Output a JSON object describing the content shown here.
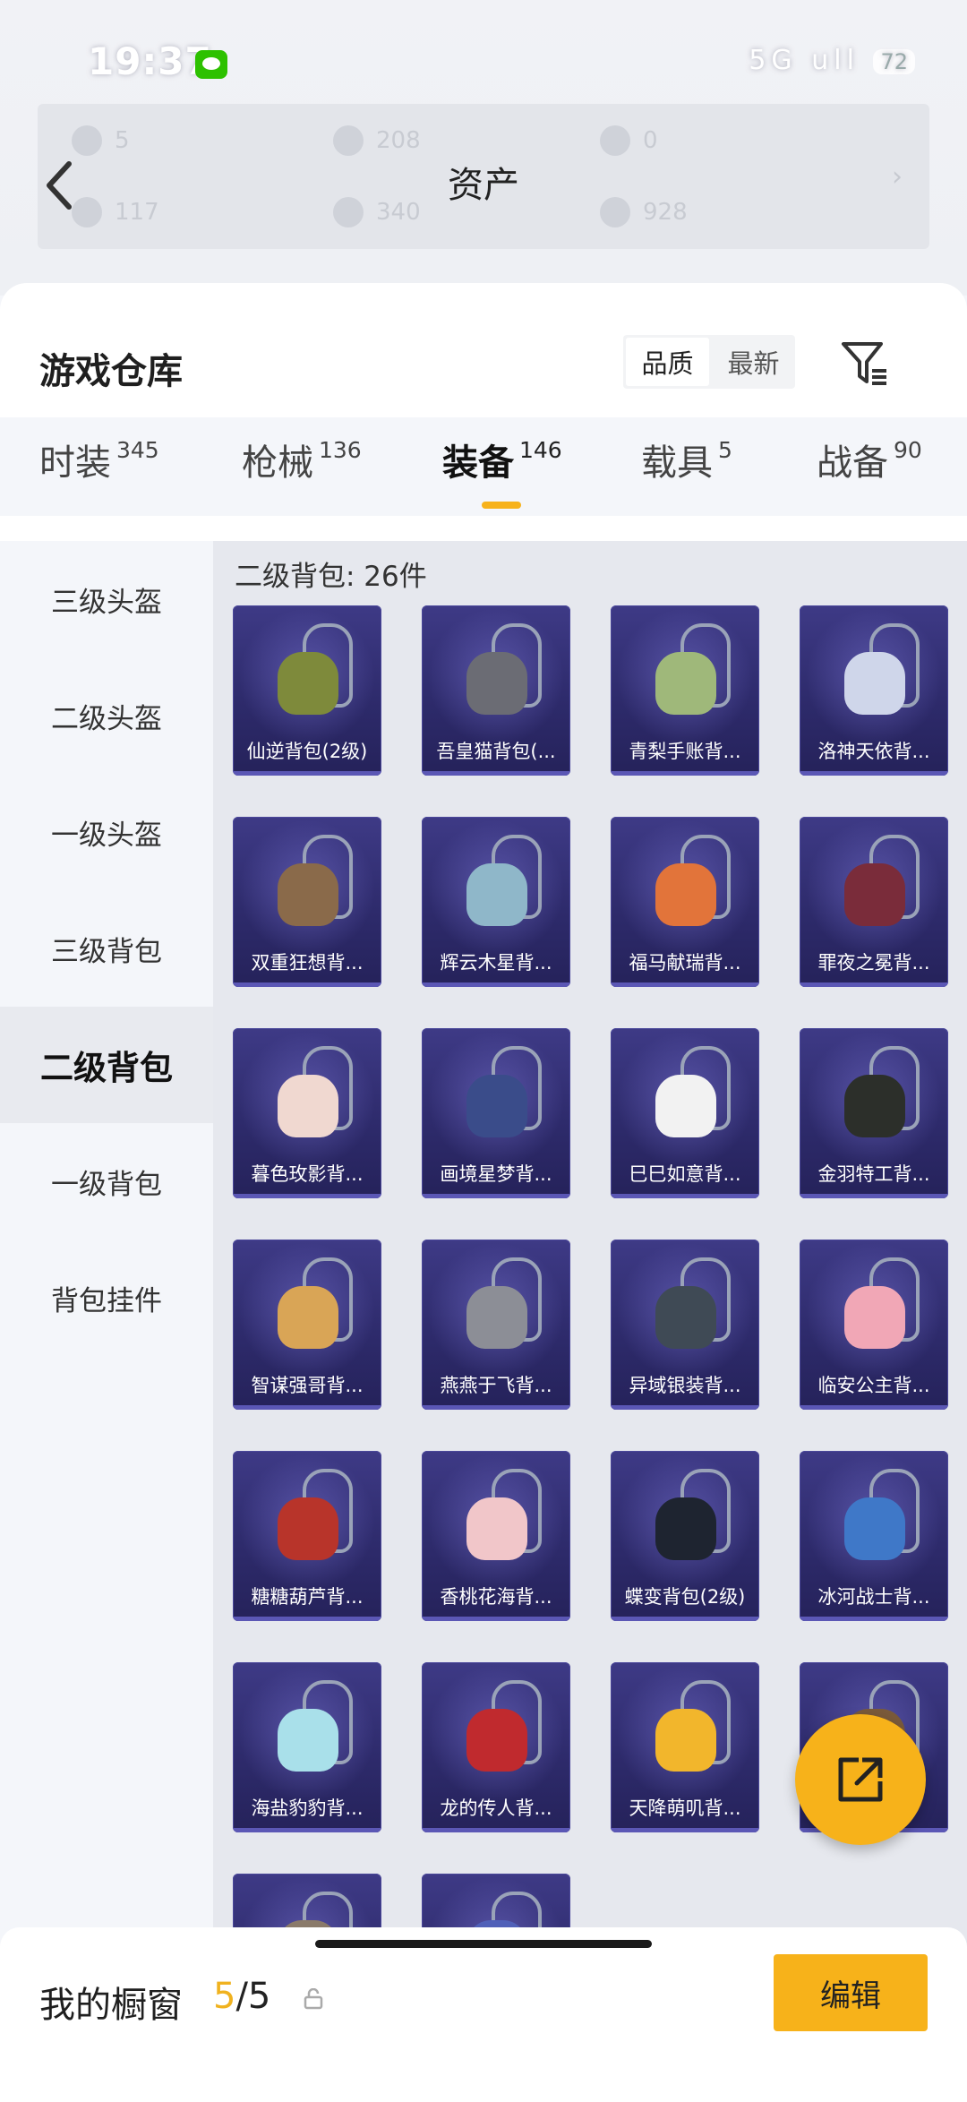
{
  "status": {
    "time": "19:37",
    "indicators": "5G ull",
    "battery": "72"
  },
  "header": {
    "title": "资产",
    "currencies": [
      {
        "value": "5"
      },
      {
        "value": "208"
      },
      {
        "value": "0"
      },
      {
        "value": "117"
      },
      {
        "value": "340"
      },
      {
        "value": "928"
      }
    ]
  },
  "warehouse": {
    "title": "游戏仓库",
    "sort": [
      "品质",
      "最新"
    ]
  },
  "tabs": [
    {
      "label": "时装",
      "count": "345"
    },
    {
      "label": "枪械",
      "count": "136"
    },
    {
      "label": "装备",
      "count": "146"
    },
    {
      "label": "载具",
      "count": "5"
    },
    {
      "label": "战备",
      "count": "90"
    }
  ],
  "sidebar": [
    "三级头盔",
    "二级头盔",
    "一级头盔",
    "三级背包",
    "二级背包",
    "一级背包",
    "背包挂件"
  ],
  "grid": {
    "label": "二级背包: 26件",
    "items": [
      {
        "name": "仙逆背包(2级)",
        "color": "#7e8a3b"
      },
      {
        "name": "吾皇猫背包(...",
        "color": "#6b6c74"
      },
      {
        "name": "青梨手账背...",
        "color": "#9fb87a"
      },
      {
        "name": "洛神天依背...",
        "color": "#cfd6ea"
      },
      {
        "name": "双重狂想背...",
        "color": "#8a6a4a"
      },
      {
        "name": "辉云木星背...",
        "color": "#8fb7c9"
      },
      {
        "name": "福马献瑞背...",
        "color": "#e2743a"
      },
      {
        "name": "罪夜之冕背...",
        "color": "#7a2c3a"
      },
      {
        "name": "暮色玫影背...",
        "color": "#f0d8d0"
      },
      {
        "name": "画境星梦背...",
        "color": "#3a4c8a"
      },
      {
        "name": "巳巳如意背...",
        "color": "#f2f2f2"
      },
      {
        "name": "金羽特工背...",
        "color": "#2c2f2a"
      },
      {
        "name": "智谋强哥背...",
        "color": "#d9a556"
      },
      {
        "name": "燕燕于飞背...",
        "color": "#8c8e96"
      },
      {
        "name": "异域银装背...",
        "color": "#3f4a55"
      },
      {
        "name": "临安公主背...",
        "color": "#f1a7b6"
      },
      {
        "name": "糖糖葫芦背...",
        "color": "#b8342a"
      },
      {
        "name": "香桃花海背...",
        "color": "#f1c6c9"
      },
      {
        "name": "蝶变背包(2级)",
        "color": "#1e2430"
      },
      {
        "name": "冰河战士背...",
        "color": "#3f78c8"
      },
      {
        "name": "海盐豹豹背...",
        "color": "#a9e0ea"
      },
      {
        "name": "龙的传人背...",
        "color": "#c02a2e"
      },
      {
        "name": "天降萌叽背...",
        "color": "#f2b62c"
      },
      {
        "name": "",
        "color": "#7a5a3a"
      },
      {
        "name": "",
        "color": "#8a7a6a"
      },
      {
        "name": "",
        "color": "#5060b8"
      }
    ]
  },
  "bottom": {
    "title": "我的橱窗",
    "used": "5",
    "total": "/5",
    "edit": "编辑"
  }
}
